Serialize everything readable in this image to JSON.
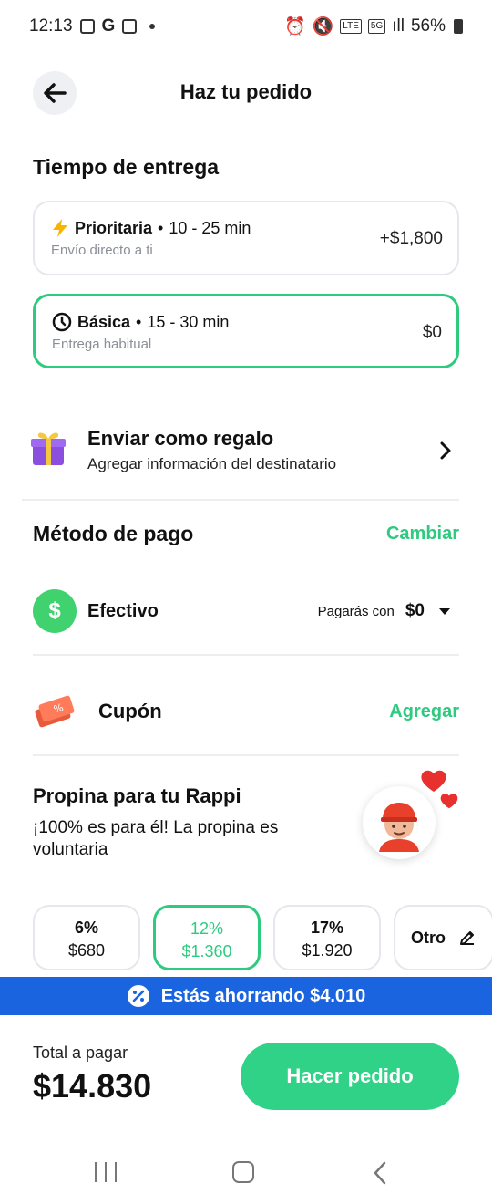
{
  "status_bar": {
    "time": "12:13",
    "battery": "56%",
    "network": "5G"
  },
  "header": {
    "title": "Haz tu pedido"
  },
  "delivery": {
    "section_title": "Tiempo de entrega",
    "options": [
      {
        "name": "Prioritaria",
        "eta": "10 - 25 min",
        "subtitle": "Envío directo a ti",
        "price": "+$1,800",
        "selected": false,
        "icon": "lightning-icon"
      },
      {
        "name": "Básica",
        "eta": "15 - 30 min",
        "subtitle": "Entrega habitual",
        "price": "$0",
        "selected": true,
        "icon": "clock-icon"
      }
    ]
  },
  "gift": {
    "title": "Enviar como regalo",
    "subtitle": "Agregar información del destinatario",
    "icon": "gift-icon"
  },
  "payment": {
    "section_title": "Método de pago",
    "change_label": "Cambiar",
    "method": "Efectivo",
    "pay_with_label": "Pagarás con",
    "pay_with_amount": "$0",
    "icon_symbol": "$"
  },
  "coupon": {
    "label": "Cupón",
    "add_label": "Agregar",
    "icon": "coupon-icon"
  },
  "tip": {
    "title": "Propina para tu Rappi",
    "subtitle": "¡100% es para él! La propina es voluntaria",
    "options": [
      {
        "percent": "6%",
        "amount": "$680",
        "selected": false
      },
      {
        "percent": "12%",
        "amount": "$1.360",
        "selected": true
      },
      {
        "percent": "17%",
        "amount": "$1.920",
        "selected": false
      }
    ],
    "other_label": "Otro"
  },
  "savings": {
    "text": "Estás ahorrando $4.010"
  },
  "footer": {
    "total_label": "Total a pagar",
    "total": "$14.830",
    "order_button": "Hacer pedido"
  },
  "colors": {
    "accent_green": "#2ecb7f",
    "savings_blue": "#1a64e0",
    "button_green": "#2fd286"
  }
}
